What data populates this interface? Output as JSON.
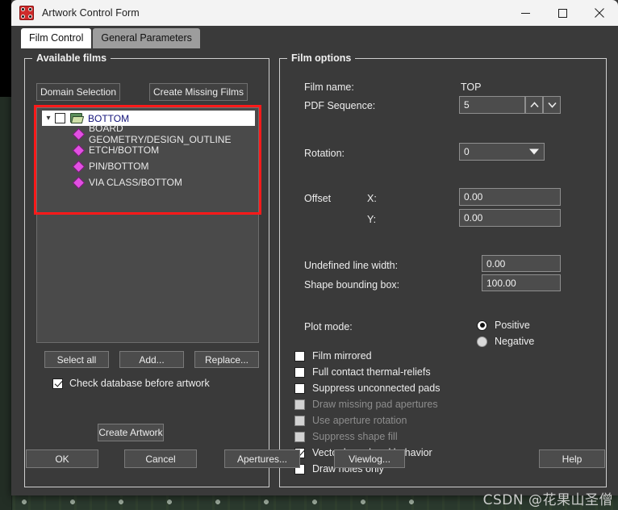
{
  "window": {
    "title": "Artwork Control Form",
    "app_icon": "artwork-pads-icon",
    "minimize_label": "Minimize",
    "maximize_label": "Maximize",
    "close_label": "Close"
  },
  "tabs": [
    {
      "label": "Film Control",
      "active": true
    },
    {
      "label": "General Parameters",
      "active": false
    }
  ],
  "available_films": {
    "legend": "Available films",
    "domain_selection_label": "Domain Selection",
    "create_missing_films_label": "Create Missing Films",
    "highlight_color": "#ff1a1a",
    "tree": {
      "root": {
        "label": "BOTTOM",
        "checked": false,
        "expanded": true,
        "icon": "folder-open-icon"
      },
      "children": [
        {
          "label": "BOARD GEOMETRY/DESIGN_OUTLINE",
          "icon": "diamond-icon"
        },
        {
          "label": "ETCH/BOTTOM",
          "icon": "diamond-icon"
        },
        {
          "label": "PIN/BOTTOM",
          "icon": "diamond-icon"
        },
        {
          "label": "VIA CLASS/BOTTOM",
          "icon": "diamond-icon"
        }
      ]
    },
    "select_all_label": "Select all",
    "add_label": "Add...",
    "replace_label": "Replace...",
    "check_db_label": "Check database before artwork",
    "check_db_checked": true,
    "create_artwork_label": "Create Artwork"
  },
  "film_options": {
    "legend": "Film options",
    "film_name_label": "Film name:",
    "film_name_value": "TOP",
    "pdf_sequence_label": "PDF Sequence:",
    "pdf_sequence_value": "5",
    "spin_up_icon": "chevron-up-icon",
    "spin_down_icon": "chevron-down-icon",
    "rotation_label": "Rotation:",
    "rotation_value": "0",
    "rotation_arrow_icon": "chevron-down-icon",
    "offset_label": "Offset",
    "offset_x_label": "X:",
    "offset_x_value": "0.00",
    "offset_y_label": "Y:",
    "offset_y_value": "0.00",
    "undefined_line_width_label": "Undefined line width:",
    "undefined_line_width_value": "0.00",
    "shape_bounding_box_label": "Shape bounding box:",
    "shape_bounding_box_value": "100.00",
    "plot_mode_label": "Plot mode:",
    "plot_modes": [
      {
        "label": "Positive",
        "selected": true
      },
      {
        "label": "Negative",
        "selected": false
      }
    ],
    "checkboxes": [
      {
        "label": "Film mirrored",
        "checked": false,
        "disabled": false
      },
      {
        "label": "Full contact thermal-reliefs",
        "checked": false,
        "disabled": false
      },
      {
        "label": "Suppress unconnected pads",
        "checked": false,
        "disabled": false
      },
      {
        "label": "Draw missing pad apertures",
        "checked": false,
        "disabled": true
      },
      {
        "label": "Use aperture rotation",
        "checked": false,
        "disabled": true
      },
      {
        "label": "Suppress shape fill",
        "checked": false,
        "disabled": true
      },
      {
        "label": "Vector based pad behavior",
        "checked": true,
        "disabled": false
      },
      {
        "label": "Draw holes only",
        "checked": false,
        "disabled": false
      }
    ]
  },
  "footer": {
    "ok_label": "OK",
    "cancel_label": "Cancel",
    "apertures_label": "Apertures...",
    "viewlog_label": "Viewlog...",
    "help_label": "Help"
  },
  "watermark": "CSDN @花果山圣僧"
}
